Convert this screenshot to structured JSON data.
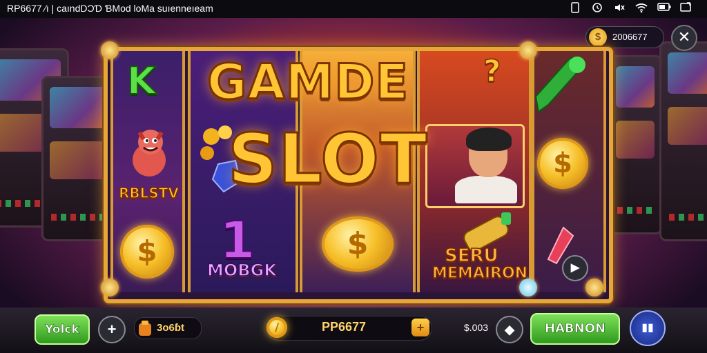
{
  "status_bar": {
    "time_text": "RP6677 ⁄ı | caındDƆƊ ƁMod ƖoMa suıenneıeam",
    "icons": [
      "tablet-icon",
      "alarm-icon",
      "mute-icon",
      "wifi-icon",
      "battery-icon",
      "cast-icon"
    ]
  },
  "top_right": {
    "balance": "2006677",
    "coin_symbol": "$",
    "close_symbol": "✕"
  },
  "title": {
    "line1": "GAMDE",
    "accent": "?",
    "line2": "SLOT"
  },
  "reels": {
    "reel1": {
      "top_label": "K",
      "mid_label": "RBLSTV",
      "coin_symbol": "$"
    },
    "reel2": {
      "big_label": "1",
      "label": "MOBGK"
    },
    "reel3": {
      "coin_symbol": "$"
    },
    "reel4": {
      "label_line1": "SERU",
      "label_line2": "MEMAIRON"
    },
    "reel5": {
      "coin_symbol": "$",
      "play_symbol": "▶"
    }
  },
  "bottom_bar": {
    "left_button": "Yolck",
    "plus_symbol": "+",
    "wallet_value": "3o6ɓt",
    "bet_minus_symbol": "/",
    "bet_value": "PP6677",
    "bet_plus_symbol": "+",
    "win_value": "$.003",
    "diamond_symbol": "◆",
    "spin_button": "HABNON",
    "menu_symbol": "▮▮"
  }
}
